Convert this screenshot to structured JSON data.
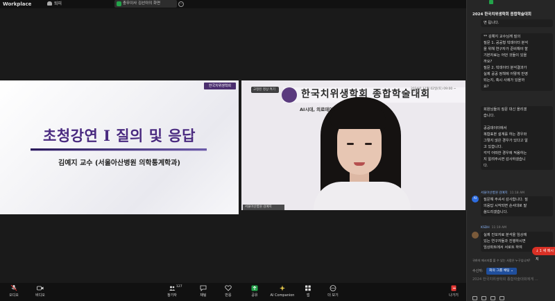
{
  "topbar": {
    "app_name": "Workplace",
    "leave_label": "퇴피",
    "chip_label": "충무이사 김선아의 화면"
  },
  "share": {
    "logo": "한국치위생학회",
    "slide_title": "초청강연 Ⅰ 질의 및 응답",
    "slide_subtitle": "김예지 교수 (서울아산병원 의학통계학과)"
  },
  "camera": {
    "badge": "고정된 영상 켜기",
    "banner_title": "한국치위생학회 종합학술대회",
    "banner_date": "2024년 11월 02일(토) 09:00 ~ 17:20",
    "banner_sub": "AI시대, 의료데이터 ... 학문의 미래 II",
    "name_tag": "서울아산병원 김예지"
  },
  "chat": {
    "header": "2024 한국치위생학회 종합학술대회",
    "messages": [
      {
        "text": "면 됩니다."
      },
      {
        "text": "** 김예지 교수님께 질의\n질문 1. 공공형 빅데이터 분석\n을 위해 연구자가 준비해야 할\n기본자료는 어떤 것들이 있을\n까요?\n질문 2. 빅데이터 분석결과가\n실제 공공 정책에 어떻게 반영\n되는지, 혹시 사례가 있을까\n요?"
      },
      {
        "text": "회원님들의 질문 대신 올리겠\n습니다.\n\n공공데이터에서\n복합표본 설계를 하는 경우와\n그렇지 않은 경우가 있다고 알\n고 있습니다.\n각각 어떠한 경우에 적용하는\n지 알려주시면 감사하겠습니\n다."
      },
      {
        "sender": "서울아산병원 김예지",
        "time": "11:18 AM",
        "avatar": "AI",
        "text": "질문해 주셔서 감사합니다. 질\n의응답 시작되면 순서대로 말\n씀드리겠습니다."
      },
      {
        "sender": "KSDH",
        "time": "11:19 AM",
        "avatar": "",
        "text": "실제 진보자료 분석을 임상에\n있는 연구자들과 진행하시면\n임상파트에서 서로트 하여"
      }
    ],
    "new_message_badge": "↓ 1 새 메시지",
    "notice": "귀하의 메시지를 볼 수 있는 사람은 누구입니까?",
    "recipient_label": "수신자:",
    "recipient_value": "회의 그룹 채팅 ⌄",
    "input_placeholder": "2024 한국치위생학회 종합학술대회에게 ..."
  },
  "toolbar": {
    "items": [
      {
        "label": "오디오",
        "icon": "mic-muted-icon"
      },
      {
        "label": "비디오",
        "icon": "video-icon"
      },
      {
        "label": "참가자",
        "icon": "participants-icon",
        "count": "127"
      },
      {
        "label": "채팅",
        "icon": "chat-icon"
      },
      {
        "label": "반응",
        "icon": "reaction-icon"
      },
      {
        "label": "공유",
        "icon": "share-icon"
      },
      {
        "label": "AI Companion",
        "icon": "ai-companion-icon"
      },
      {
        "label": "앱",
        "icon": "apps-icon"
      },
      {
        "label": "더 보기",
        "icon": "more-icon"
      },
      {
        "label": "나가기",
        "icon": "leave-icon"
      }
    ]
  },
  "colors": {
    "accent_green": "#23a34a",
    "accent_red": "#d93025",
    "accent_blue": "#1f4e9c",
    "slide_purple": "#4a2a80"
  }
}
